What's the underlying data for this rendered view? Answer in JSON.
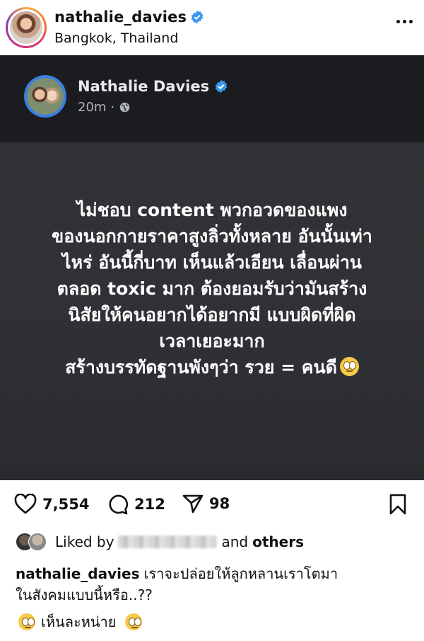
{
  "header": {
    "username": "nathalie_davies",
    "location": "Bangkok, Thailand"
  },
  "embedded_post": {
    "author": "Nathalie Davies",
    "time": "20m",
    "separator": "·",
    "text_lines": [
      "ไม่ชอบ content พวกอวดของแพง",
      "ของนอกกายราคาสูงลิ่วทั้งหลาย อันนั้นเท่า",
      "ไหร่ อันนี้กี่บาท เห็นแล้วเอียน เลื่อนผ่าน",
      "ตลอด toxic มาก ต้องยอมรับว่ามันสร้าง",
      "นิสัยให้คนอยากได้อยากมี แบบผิดที่ผิด",
      "เวลาเยอะมาก",
      "สร้างบรรทัดฐานพังๆว่า รวย = คนดี"
    ]
  },
  "actions": {
    "likes": "7,554",
    "comments": "212",
    "shares": "98"
  },
  "liked_by": {
    "prefix": "Liked by",
    "middle": "and",
    "suffix": "others"
  },
  "caption": {
    "username": "nathalie_davies",
    "line1": "เราจะปล่อยให้ลูกหลานเราโตมา",
    "line2": "ในสังคมแบบนี้หรือ..??",
    "line3": "เห็นละหน่าย"
  },
  "colors": {
    "verified": "#3897f0",
    "dark_bg": "#2f3035",
    "fb_header_bg": "#1b1c1f"
  }
}
